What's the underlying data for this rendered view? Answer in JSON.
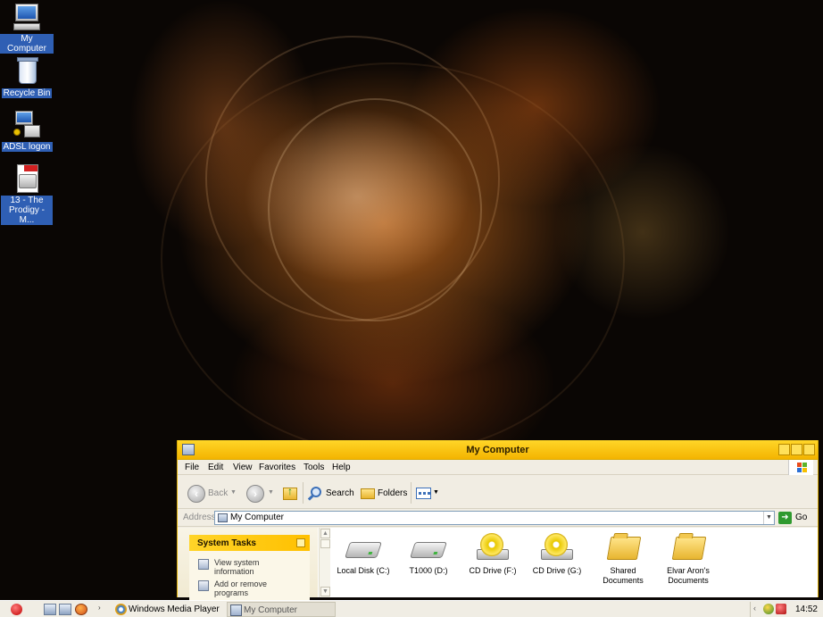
{
  "desktop": {
    "icons": [
      {
        "label": "My Computer",
        "icon": "my-computer-icon"
      },
      {
        "label": "Recycle Bin",
        "icon": "recycle-bin-icon"
      },
      {
        "label": "ADSL logon",
        "icon": "network-connection-icon"
      },
      {
        "label": "13 - The Prodigy - M...",
        "icon": "mp3-file-icon"
      }
    ]
  },
  "window": {
    "title": "My Computer",
    "menu": [
      "File",
      "Edit",
      "View",
      "Favorites",
      "Tools",
      "Help"
    ],
    "toolbar": {
      "back": "Back",
      "search": "Search",
      "folders": "Folders"
    },
    "address": {
      "label": "Address",
      "value": "My Computer",
      "go": "Go"
    },
    "system_tasks": {
      "title": "System Tasks",
      "items": [
        "View system information",
        "Add or remove programs"
      ]
    },
    "drives": [
      {
        "label": "Local Disk (C:)",
        "icon": "hard-disk-icon"
      },
      {
        "label": "T1000 (D:)",
        "icon": "hard-disk-icon"
      },
      {
        "label": "CD Drive (F:)",
        "icon": "cd-drive-icon"
      },
      {
        "label": "CD Drive (G:)",
        "icon": "cd-drive-icon"
      },
      {
        "label": "Shared Documents",
        "icon": "folder-icon"
      },
      {
        "label": "Elvar Aron's Documents",
        "icon": "folder-icon"
      }
    ]
  },
  "taskbar": {
    "tasks": [
      {
        "label": "Windows Media Player",
        "icon": "media-player-icon"
      },
      {
        "label": "My Computer",
        "icon": "my-computer-icon"
      }
    ],
    "clock": "14:52"
  },
  "colors": {
    "title_bar": "#f4b400",
    "taskbar": "#f0ede4",
    "icon_label_bg": "#2f5fb4"
  }
}
